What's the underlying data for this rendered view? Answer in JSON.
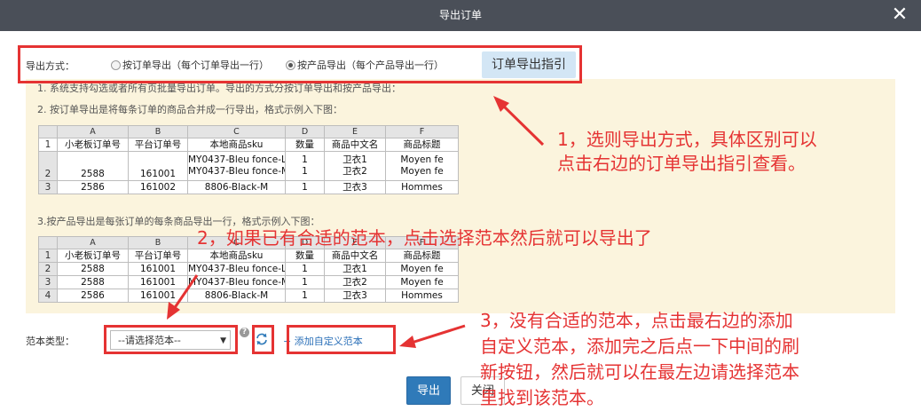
{
  "dialog": {
    "title": "导出订单",
    "close_symbol": "✕"
  },
  "export_method": {
    "label": "导出方式：",
    "options": [
      {
        "label": "按订单导出（每个订单导出一行）",
        "selected": false
      },
      {
        "label": "按产品导出（每个产品导出一行）",
        "selected": true
      }
    ],
    "guide_button": "订单导出指引"
  },
  "instructions": {
    "line1": "1. 系统支持勾选或者所有页批量导出订单。导出的方式分按订单导出和按产品导出：",
    "line2": "2. 按订单导出是将每条订单的商品合并成一行导出，格式示例入下图：",
    "line3": "3.按产品导出是每张订单的每条商品导出一行，格式示例入下图："
  },
  "table1": {
    "col_letters": [
      "A",
      "B",
      "C",
      "D",
      "E",
      "F"
    ],
    "headers": [
      "小老板订单号",
      "平台订单号",
      "本地商品sku",
      "数量",
      "商品中文名",
      "商品标题"
    ],
    "rows": [
      {
        "num": "1",
        "cells": [
          "小老板订单号",
          "平台订单号",
          "本地商品sku",
          "数量",
          "商品中文名",
          "商品标题"
        ]
      },
      {
        "num": "2",
        "a": "2588",
        "b": "161001",
        "c1": "MY0437-Bleu fonce-L",
        "c2": "MY0437-Bleu fonce-M",
        "d1": "1",
        "d2": "1",
        "e1": "卫衣1",
        "e2": "卫衣2",
        "f1": "Moyen fe",
        "f2": "Moyen fe"
      },
      {
        "num": "3",
        "a": "2586",
        "b": "161002",
        "c": "8806-Black-M",
        "d": "1",
        "e": "卫衣3",
        "f": "Hommes"
      }
    ]
  },
  "table2": {
    "col_letters": [
      "A",
      "B",
      "C",
      "D",
      "E",
      "F"
    ],
    "rows": [
      {
        "num": "1",
        "cells": [
          "小老板订单号",
          "平台订单号",
          "本地商品sku",
          "数量",
          "商品中文名",
          "商品标题"
        ]
      },
      {
        "num": "2",
        "cells": [
          "2588",
          "161001",
          "MY0437-Bleu fonce-L",
          "1",
          "卫衣1",
          "Moyen fe"
        ]
      },
      {
        "num": "3",
        "cells": [
          "2588",
          "161001",
          "MY0437-Bleu fonce-M",
          "1",
          "卫衣2",
          "Moyen fe"
        ]
      },
      {
        "num": "4",
        "cells": [
          "2586",
          "161001",
          "8806-Black-M",
          "1",
          "卫衣3",
          "Hommes"
        ]
      }
    ]
  },
  "template": {
    "label": "范本类型：",
    "select_value": "--请选择范本--",
    "help_symbol": "?",
    "add_prefix": "+",
    "add_link": "添加自定义范本"
  },
  "buttons": {
    "export": "导出",
    "close": "关闭"
  },
  "annotations": {
    "a1_line1": "1，选则导出方式，具体区别可以",
    "a1_line2": "点击右边的订单导出指引查看。",
    "a2": "2，如果已有合适的范本，点击选择范本然后就可以导出了",
    "a3_line1": "3，没有合适的范本，点击最右边的添加",
    "a3_line2": "自定义范本，添加完之后点一下中间的刷",
    "a3_line3": "新按钮，然后就可以在最左边请选择范本",
    "a3_line4": "里找到该范本。"
  },
  "colors": {
    "header": "#4a4f58",
    "panel": "#fbf4dd",
    "annotation_red": "#e53333",
    "primary_button": "#2f7ab9",
    "link": "#2a6fb8"
  }
}
